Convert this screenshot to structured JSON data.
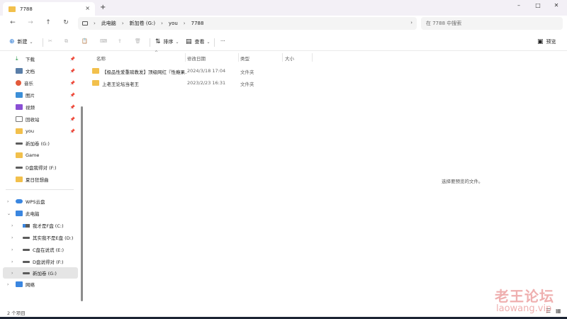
{
  "window": {
    "tab_title": "7788",
    "tab_close": "×",
    "new_tab": "+",
    "controls": {
      "minimize": "–",
      "maximize": "□",
      "close": "✕"
    }
  },
  "nav": {
    "back": "←",
    "forward": "→",
    "up": "↑",
    "refresh": "↻",
    "breadcrumb": [
      "此电脑",
      "新加卷 (G:)",
      "you",
      "7788"
    ],
    "crumb_sep": "›",
    "more": "›",
    "search_placeholder": "在 7788 中搜索"
  },
  "toolbar": {
    "new": "新建",
    "sort": "排序",
    "view": "查看",
    "more": "···",
    "preview": "预览"
  },
  "sidebar": {
    "pinned": [
      {
        "label": "下载",
        "icon": "download-icon"
      },
      {
        "label": "文档",
        "icon": "document-icon"
      },
      {
        "label": "音乐",
        "icon": "music-icon"
      },
      {
        "label": "图片",
        "icon": "picture-icon"
      },
      {
        "label": "视频",
        "icon": "video-icon"
      },
      {
        "label": "回收站",
        "icon": "recycle-bin-icon"
      },
      {
        "label": "you",
        "icon": "folder-icon"
      }
    ],
    "recent": [
      {
        "label": "新加卷 (G:)",
        "icon": "drive-icon"
      },
      {
        "label": "Game",
        "icon": "folder-icon"
      },
      {
        "label": "D盘我得对 (F:)",
        "icon": "drive-icon"
      },
      {
        "label": "夏日狂想曲",
        "icon": "folder-icon"
      }
    ],
    "tree": [
      {
        "label": "WPS云盘",
        "icon": "cloud-icon",
        "expanded": false
      },
      {
        "label": "此电脑",
        "icon": "computer-icon",
        "expanded": true
      },
      {
        "label": "我才是F盘 (C:)",
        "icon": "windows-drive-icon"
      },
      {
        "label": "其实我不是E盘 (D:)",
        "icon": "drive-icon"
      },
      {
        "label": "C盘在说谎 (E:)",
        "icon": "drive-icon"
      },
      {
        "label": "D盘说得对 (F:)",
        "icon": "drive-icon"
      },
      {
        "label": "新加卷 (G:)",
        "icon": "drive-icon",
        "selected": true
      },
      {
        "label": "网络",
        "icon": "network-icon",
        "expanded": false
      }
    ]
  },
  "columns": {
    "name": "名称",
    "date": "修改日期",
    "type": "类型",
    "size": "大小"
  },
  "files": [
    {
      "name": "【极品性爱重磅教发】顶级网红『性瘾果...",
      "date": "2024/3/18 17:04",
      "type": "文件夹"
    },
    {
      "name": "上老王论坛当老王",
      "date": "2023/2/23 16:31",
      "type": "文件夹"
    }
  ],
  "preview_message": "选择要预览的文件。",
  "status": {
    "count": "2 个项目"
  },
  "watermark": {
    "line1": "老王论坛",
    "line2": "laowang.vip"
  }
}
